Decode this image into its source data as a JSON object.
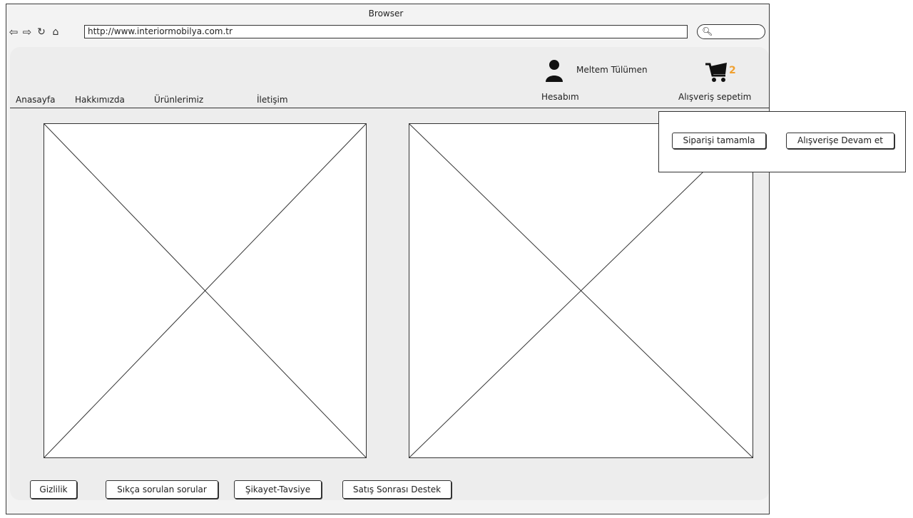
{
  "browser": {
    "title": "Browser",
    "url": "http://www.interiormobilya.com.tr",
    "nav_icons": [
      "back-arrow-icon",
      "forward-arrow-icon",
      "reload-icon",
      "home-icon"
    ],
    "search_icon": "magnifier-icon"
  },
  "nav": {
    "items": [
      {
        "label": "Anasayfa"
      },
      {
        "label": "Hakkımızda"
      },
      {
        "label": "Ürünlerimiz"
      },
      {
        "label": "İletişim"
      }
    ]
  },
  "account": {
    "user_name": "Meltem Tülümen",
    "account_label": "Hesabım",
    "cart_label": "Alışveriş sepetim",
    "cart_count": "2",
    "cart_count_color": "#f0a030"
  },
  "cart_popup": {
    "checkout_label": "Siparişi tamamla",
    "continue_label": "Alışverişe Devam et"
  },
  "footer": {
    "links": [
      {
        "label": "Gizlilik"
      },
      {
        "label": "Sıkça sorulan sorular"
      },
      {
        "label": "Şikayet-Tavsiye"
      },
      {
        "label": "Satış Sonrası Destek"
      }
    ]
  }
}
